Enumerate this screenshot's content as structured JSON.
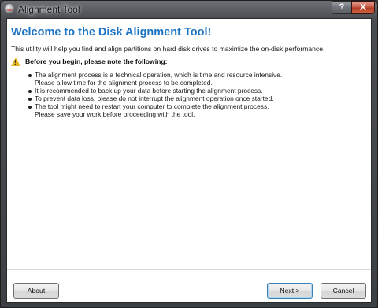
{
  "window": {
    "title": "Alignment Tool"
  },
  "titlebar_buttons": {
    "help": "?",
    "close": "X"
  },
  "content": {
    "heading": "Welcome to the Disk Alignment Tool!",
    "intro": "This utility will help you find and align partitions on hard disk drives to maximize the on-disk performance.",
    "warning_title": "Before you begin, please note the following:",
    "warning_icon": "warning-icon",
    "bullets": [
      [
        "The alignment process is a technical operation, which is time and resource intensive.",
        "Please allow time for the alignment process to be completed."
      ],
      [
        "It is recommended to back up your data before starting the alignment process."
      ],
      [
        "To prevent data loss, please do not interrupt the alignment operation once started."
      ],
      [
        "The tool might need to restart your computer to complete the alignment process.",
        "Please save your work before proceeding with the tool."
      ]
    ]
  },
  "buttons": {
    "about": "About",
    "next": "Next >",
    "cancel": "Cancel"
  },
  "colors": {
    "heading": "#1b73c4",
    "warning": "#e6b422",
    "close_button": "#c75b43"
  }
}
